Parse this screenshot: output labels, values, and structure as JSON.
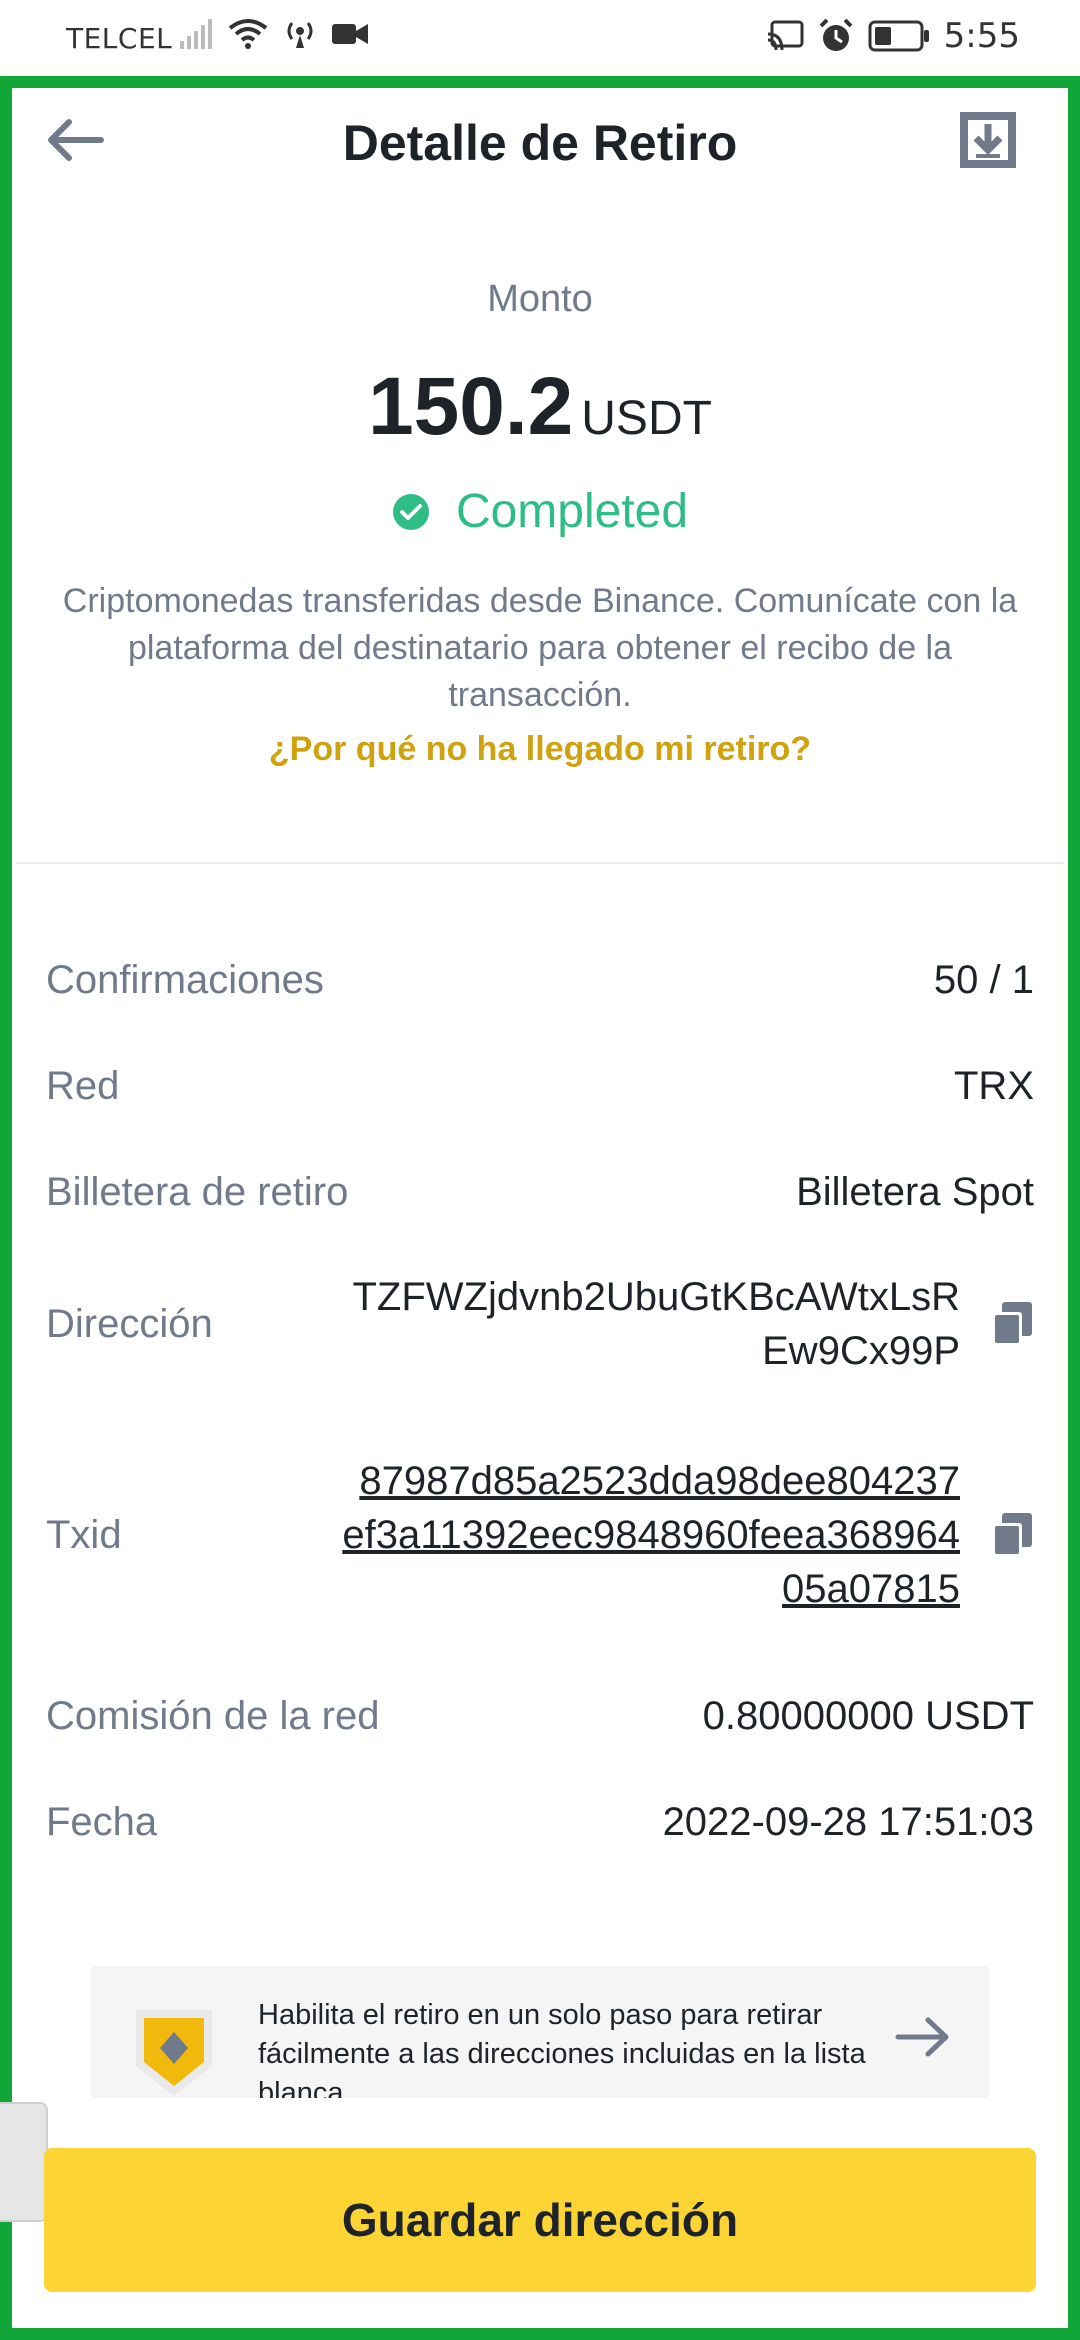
{
  "status_bar": {
    "carrier": "TELCEL",
    "time": "5:55",
    "icons": [
      "signal-icon",
      "wifi-icon",
      "hotspot-icon",
      "video-icon",
      "cast-icon",
      "alarm-icon",
      "battery-icon"
    ]
  },
  "header": {
    "title": "Detalle de Retiro"
  },
  "amount": {
    "label": "Monto",
    "value": "150.2",
    "unit": "USDT"
  },
  "status": {
    "text": "Completed",
    "color": "#2ebd85"
  },
  "description": "Criptomonedas transferidas desde Binance. Comunícate con la plataforma del destinatario para obtener el recibo de la transacción.",
  "help_link": "¿Por qué no ha llegado mi retiro?",
  "details": {
    "confirmations": {
      "label": "Confirmaciones",
      "value": "50 / 1"
    },
    "network": {
      "label": "Red",
      "value": "TRX"
    },
    "wallet": {
      "label": "Billetera de retiro",
      "value": "Billetera Spot"
    },
    "address": {
      "label": "Dirección",
      "value": "TZFWZjdvnb2UbuGtKBcAWtxLsREw9Cx99P"
    },
    "txid": {
      "label": "Txid",
      "value": "87987d85a2523dda98dee804237ef3a11392eec9848960feea36896405a07815"
    },
    "fee": {
      "label": "Comisión de la red",
      "value": "0.80000000 USDT"
    },
    "date": {
      "label": "Fecha",
      "value": "2022-09-28 17:51:03"
    }
  },
  "banner": {
    "text": "Habilita el retiro en un solo paso para retirar fácilmente a las direcciones incluidas en la lista blanca"
  },
  "save_button": "Guardar dirección",
  "colors": {
    "accent": "#fcd535",
    "link": "#d0a20e",
    "frame": "#12a537"
  }
}
